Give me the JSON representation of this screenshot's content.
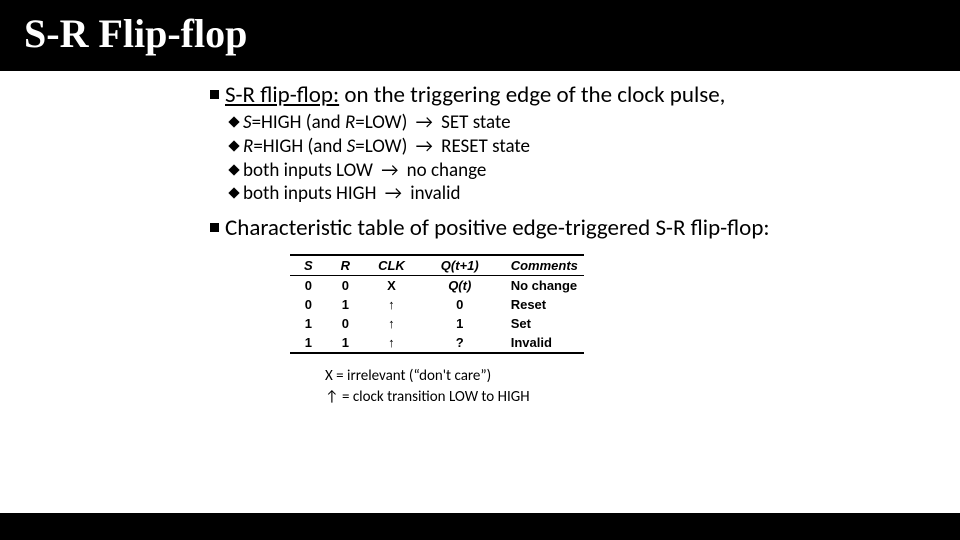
{
  "title": "S-R Flip-flop",
  "bullet1": {
    "lead": "S-R flip-flop:",
    "tail": " on the triggering edge of the clock pulse,"
  },
  "sub": [
    {
      "pre_i": "S",
      "pre": "=HIGH (and ",
      "pre2_i": "R",
      "pre2": "=LOW) ",
      "arr": "→",
      "post": " SET state"
    },
    {
      "pre_i": "R",
      "pre": "=HIGH (and ",
      "pre2_i": "S",
      "pre2": "=LOW) ",
      "arr": "→",
      "post": " RESET state"
    },
    {
      "pre": "both inputs LOW ",
      "arr": "→",
      "post": " no change"
    },
    {
      "pre": "both inputs HIGH ",
      "arr": "→",
      "post": " invalid"
    }
  ],
  "bullet2": "Characteristic table of positive edge-triggered S-R flip-flop:",
  "table": {
    "headers": [
      "S",
      "R",
      "CLK",
      "Q(t+1)",
      "Comments"
    ],
    "rows": [
      {
        "s": "0",
        "r": "0",
        "clk": "X",
        "q": "Q(t)",
        "q_ital": true,
        "c": "No change"
      },
      {
        "s": "0",
        "r": "1",
        "clk": "↑",
        "q": "0",
        "q_ital": false,
        "c": "Reset"
      },
      {
        "s": "1",
        "r": "0",
        "clk": "↑",
        "q": "1",
        "q_ital": false,
        "c": "Set"
      },
      {
        "s": "1",
        "r": "1",
        "clk": "↑",
        "q": "?",
        "q_ital": false,
        "c": "Invalid"
      }
    ]
  },
  "legend": {
    "l1": "X = irrelevant (“don't care”)",
    "l2": "↑ = clock transition LOW to HIGH"
  }
}
